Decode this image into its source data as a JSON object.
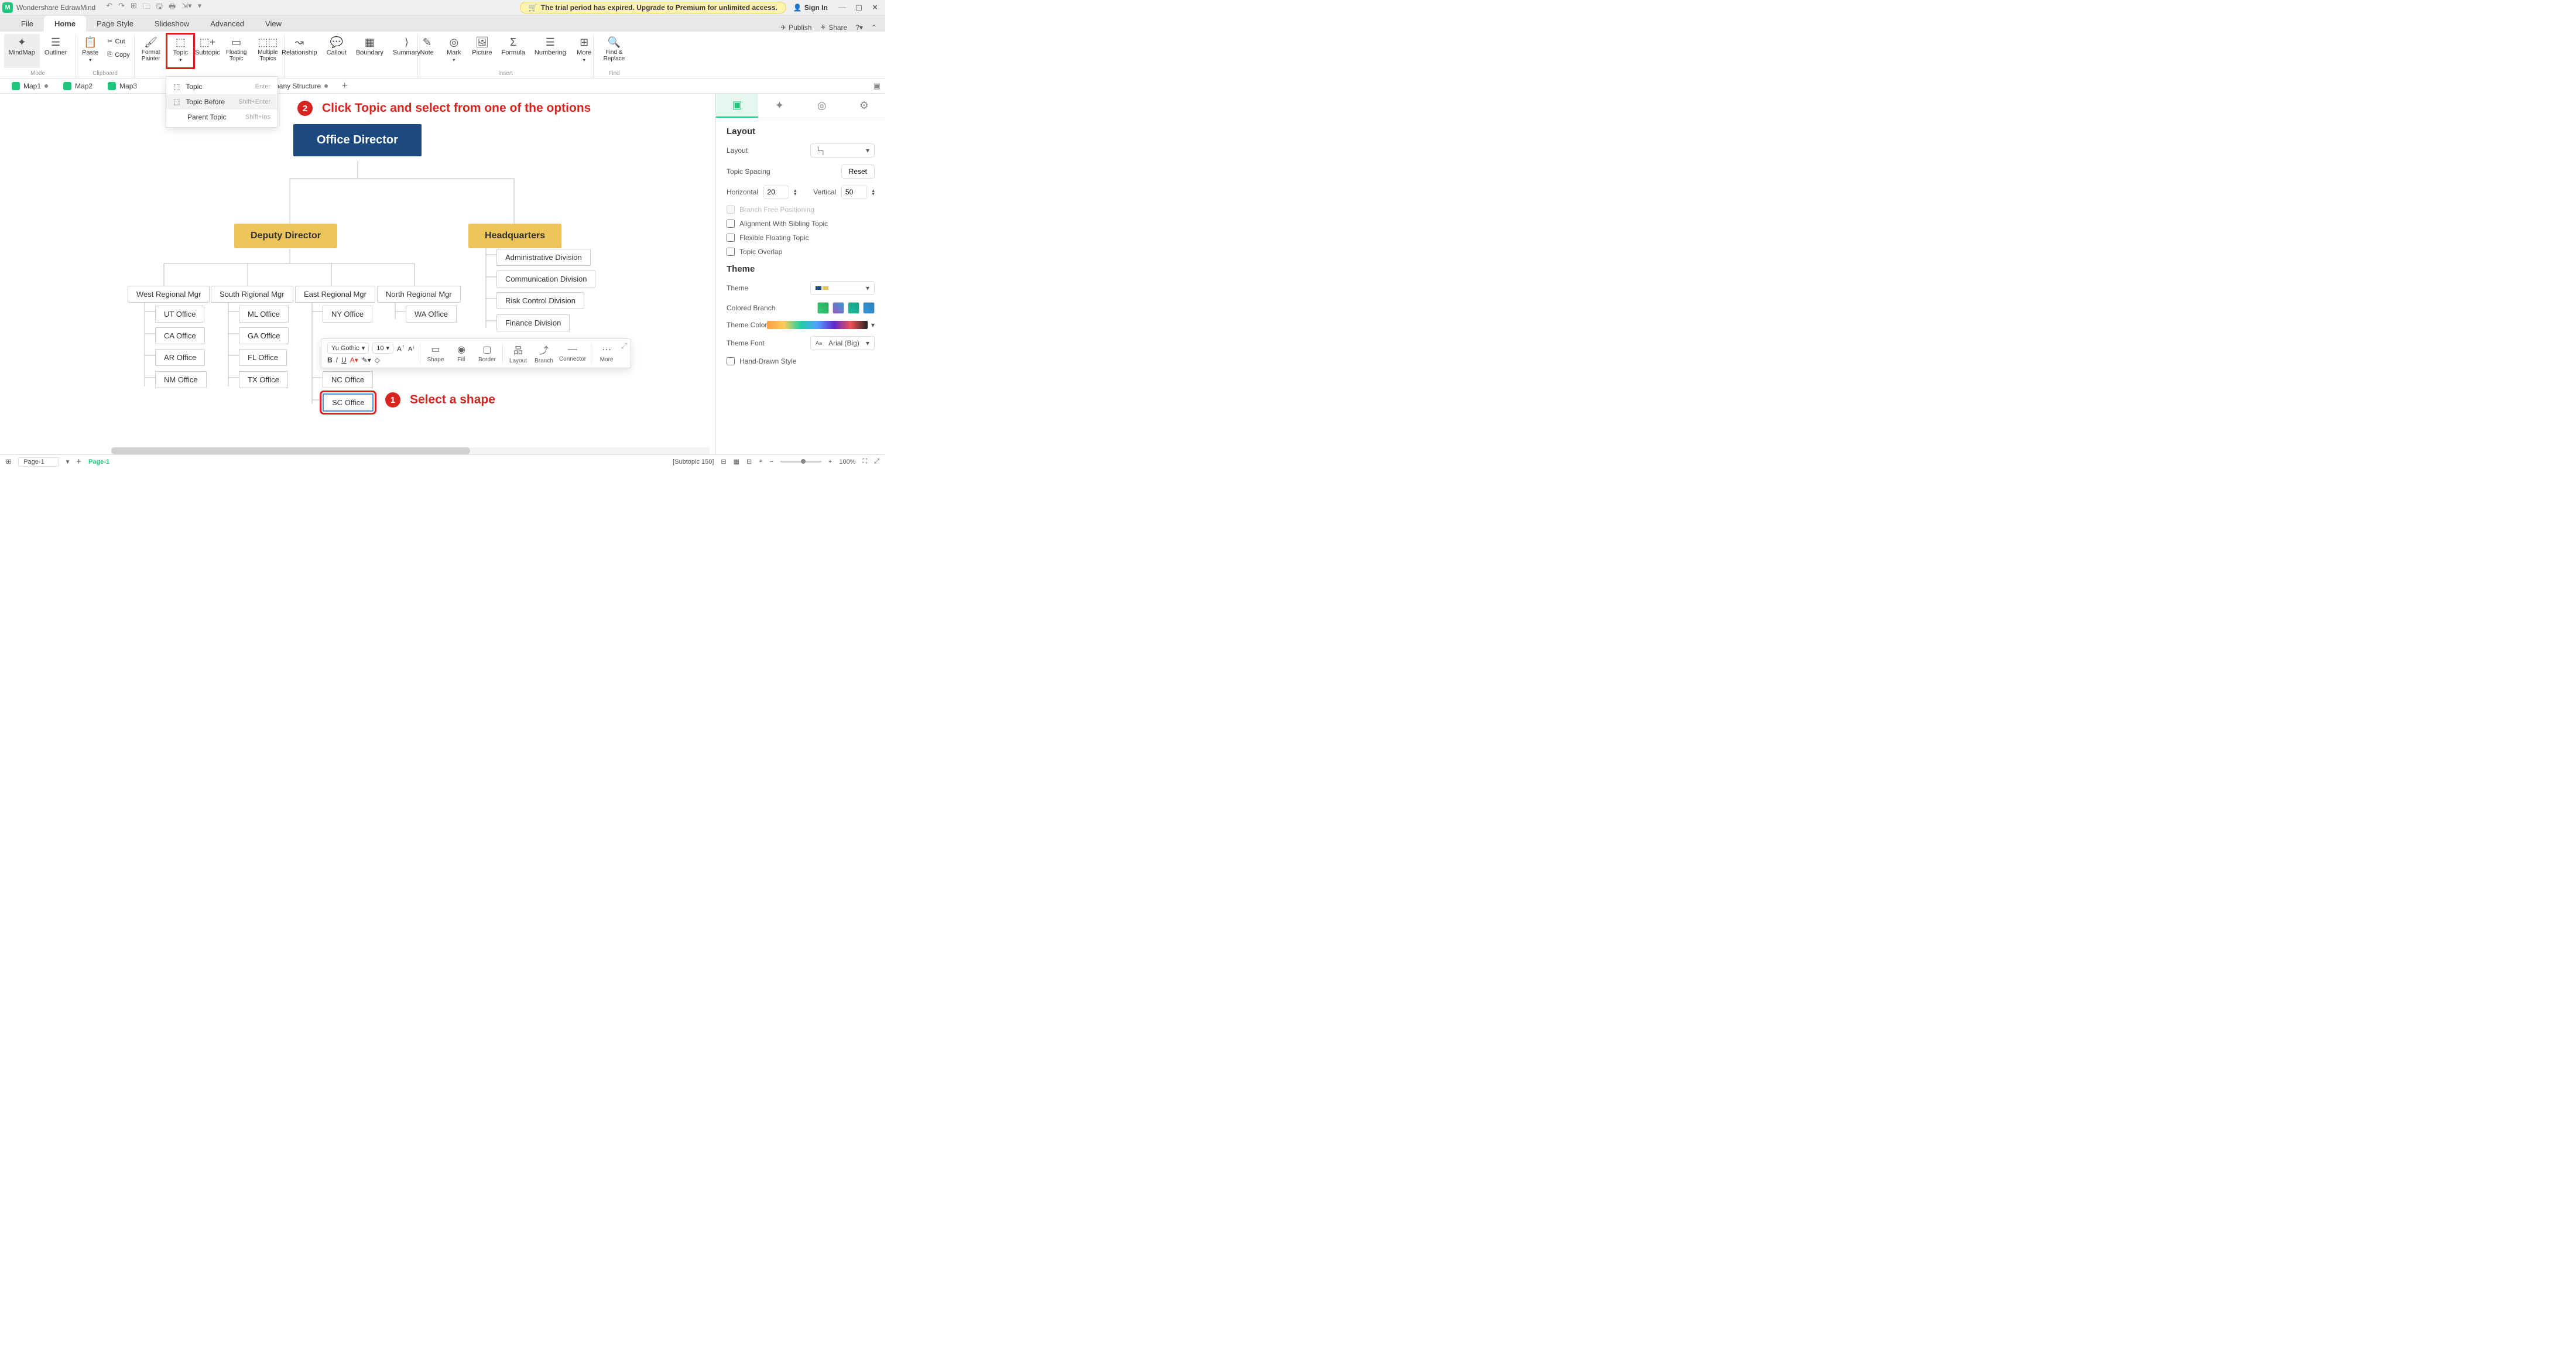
{
  "app": {
    "title": "Wondershare EdrawMind",
    "trial_msg": "The trial period has expired. Upgrade to Premium for unlimited access.",
    "signin": "Sign In"
  },
  "menu": {
    "file": "File",
    "home": "Home",
    "pagestyle": "Page Style",
    "slideshow": "Slideshow",
    "advanced": "Advanced",
    "view": "View",
    "publish": "Publish",
    "share": "Share"
  },
  "ribbon": {
    "mode": "Mode",
    "clipboard": "Clipboard",
    "insert": "Insert",
    "find": "Find",
    "mindmap": "MindMap",
    "outliner": "Outliner",
    "paste": "Paste",
    "cut": "Cut",
    "copy": "Copy",
    "format_painter": "Format Painter",
    "topic": "Topic",
    "subtopic": "Subtopic",
    "floating": "Floating Topic",
    "multiple": "Multiple Topics",
    "relationship": "Relationship",
    "callout": "Callout",
    "boundary": "Boundary",
    "summary": "Summary",
    "note": "Note",
    "mark": "Mark",
    "picture": "Picture",
    "formula": "Formula",
    "numbering": "Numbering",
    "more": "More",
    "findreplace": "Find & Replace"
  },
  "topic_dd": {
    "topic": "Topic",
    "topic_sc": "Enter",
    "before": "Topic Before",
    "before_sc": "Shift+Enter",
    "parent": "Parent Topic",
    "parent_sc": "Shift+Ins"
  },
  "doctabs": {
    "m1": "Map1",
    "m2": "Map2",
    "m3": "Map3",
    "m4": "pany Structure"
  },
  "chart_data": {
    "type": "org",
    "root": "Office Director",
    "branches": [
      {
        "name": "Deputy Director",
        "children": [
          {
            "name": "West Regional Mgr",
            "offices": [
              "UT Office",
              "CA Office",
              "AR Office",
              "NM Office"
            ]
          },
          {
            "name": "South Rigional Mgr",
            "offices": [
              "ML Office",
              "GA Office",
              "FL Office",
              "TX Office"
            ]
          },
          {
            "name": "East Regional Mgr",
            "offices": [
              "NY Office",
              "NC Office",
              "SC Office"
            ]
          },
          {
            "name": "North Regional Mgr",
            "offices": [
              "WA Office"
            ]
          }
        ]
      },
      {
        "name": "Headquarters",
        "divisions": [
          "Administrative Division",
          "Communication Division",
          "Risk Control Division",
          "Finance Division"
        ]
      }
    ],
    "selected": "SC Office"
  },
  "org": {
    "director": "Office Director",
    "deputy": "Deputy Director",
    "hq": "Headquarters",
    "west": "West Regional Mgr",
    "south": "South Rigional Mgr",
    "east": "East Regional Mgr",
    "north": "North Regional Mgr",
    "ut": "UT Office",
    "ca": "CA Office",
    "ar": "AR Office",
    "nm": "NM Office",
    "ml": "ML Office",
    "ga": "GA Office",
    "fl": "FL Office",
    "tx": "TX Office",
    "ny": "NY Office",
    "nc": "NC Office",
    "sc": "SC Office",
    "wa": "WA Office",
    "admin": "Administrative Division",
    "comm": "Communication Division",
    "risk": "Risk Control Division",
    "fin": "Finance Division"
  },
  "anno": {
    "a1": "Select a shape",
    "a2": "Click Topic and select from one of the options",
    "n1": "1",
    "n2": "2"
  },
  "float": {
    "font": "Yu Gothic",
    "size": "10",
    "shape": "Shape",
    "fill": "Fill",
    "border": "Border",
    "layout": "Layout",
    "branch": "Branch",
    "connector": "Connector",
    "more": "More"
  },
  "rpanel": {
    "layout_h": "Layout",
    "layout": "Layout",
    "spacing": "Topic Spacing",
    "reset": "Reset",
    "horizontal": "Horizontal",
    "hval": "20",
    "vertical": "Vertical",
    "vval": "50",
    "branch_free": "Branch Free Positioning",
    "align_sibling": "Alignment With Sibling Topic",
    "flex_float": "Flexible Floating Topic",
    "overlap": "Topic Overlap",
    "theme_h": "Theme",
    "theme": "Theme",
    "colored_branch": "Colored Branch",
    "theme_color": "Theme Color",
    "theme_font": "Theme Font",
    "font_val": "Arial (Big)",
    "hand_drawn": "Hand-Drawn Style"
  },
  "status": {
    "page1": "Page-1",
    "page1b": "Page-1",
    "subtopic": "[Subtopic 150]",
    "zoom": "100%"
  }
}
